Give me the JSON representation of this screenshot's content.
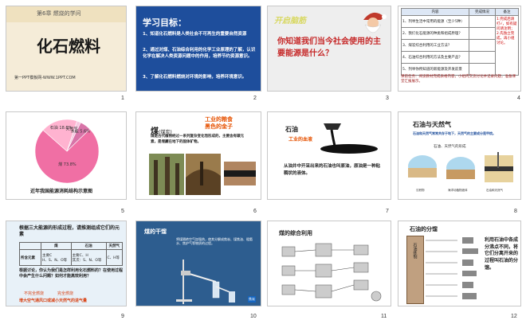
{
  "numbers": [
    "1",
    "2",
    "3",
    "4",
    "5",
    "6",
    "7",
    "8",
    "9",
    "10",
    "11",
    "12"
  ],
  "s1": {
    "chapter": "第6章 燃烧的学问",
    "title": "化石燃料",
    "site": "第一PPT模板网-WWW.1PPT.COM"
  },
  "s2": {
    "heading": "学习目标：",
    "items": [
      "1、知道化石燃料是人类社会不可再生的重要自然资源",
      "2、通过对煤、石油综合利用的化学工业原理的了解，认识化学在解决人类资源问题中的作用，培养节约资源意识。",
      "3、了解化石燃料燃烧对环境的影响，培养环境意识。"
    ]
  },
  "s3": {
    "title": "开启脑筋",
    "question": "你知道我们当今社会使用的主要能源是什么？"
  },
  "s4": {
    "head_content": "内容",
    "head_status": "完成情况",
    "head_note": "备注",
    "rows": [
      "1、列举生活中常用的能源（至少5种）",
      "2、我们化石能源的种类和组成原理？",
      "3、煤炭综合利用的工业方法？",
      "4、石油综合利用的方法及主要产品？",
      "5、列举你所知道的新能源及开发前景"
    ],
    "note": "1.完成后请打√，如有疑问请注明；2.先独立完成，再小组讨论。",
    "footer": "课前任务：阅读教材完成表格内容，小组内交流讨论并记录问题，准备课堂汇报展示。"
  },
  "s5": {
    "caption": "近年我国能源消耗结构示意图",
    "slices": [
      {
        "label": "煤",
        "value": 73.8
      },
      {
        "label": "石油",
        "value": 18.6
      },
      {
        "label": "天然气",
        "value": 2.0
      },
      {
        "label": "水能",
        "value": 5.6
      }
    ]
  },
  "s6": {
    "title": "煤",
    "subtitle": "(煤炭)",
    "tag1": "工业的粮食",
    "tag2": "黑色的金子",
    "desc": "煤是古代植物经过一系列复杂变化而形成的，主要含有碳元素，是埋藏在地下的固体矿物。"
  },
  "s7": {
    "title": "石油",
    "tag": "工业的血液",
    "desc": "从油井中开采出来的石油也叫原油，原油是一种粘稠状的液体。"
  },
  "s8": {
    "title": "石油与天然气",
    "desc": "石油和天然气常常共存于地下，天然气的主要成分是甲烷。",
    "diagram_title": "石油、天然气的形成",
    "label_left": "沉积物",
    "label_mid": "海洋动植物遗体",
    "label_right": "石油和天然气"
  },
  "s9": {
    "question": "根据三大能源的形成过程，请推测组成它们的元素",
    "headers": [
      "",
      "煤",
      "石油",
      "天然气"
    ],
    "row_label": "所含元素",
    "cells": [
      "主要C\nH、S、N、O等",
      "主要C、H\n其次：S、N、O等",
      "C、H等"
    ],
    "q2": "根据讨论，你认为我们是怎样利用化石燃料的？在使用过程中会产生什么问题？如何才能高效利用？",
    "t1": "不完全燃烧",
    "t2": "完全燃烧",
    "bottom": "增大空气通风口或减小天然气的进气量"
  },
  "s10": {
    "title": "煤的干馏",
    "desc": "将煤隔绝空气加强热，使其分解成焦炭、煤焦油、粗氨水、焦炉气等物质的过程。",
    "tag": "焦炭"
  },
  "s11": {
    "title": "煤的综合利用"
  },
  "s12": {
    "title": "石油的分馏",
    "column": "石油炼制",
    "side": "利用石油中各成分沸点不同，将它们分离开来的过程叫石油的分馏。"
  }
}
